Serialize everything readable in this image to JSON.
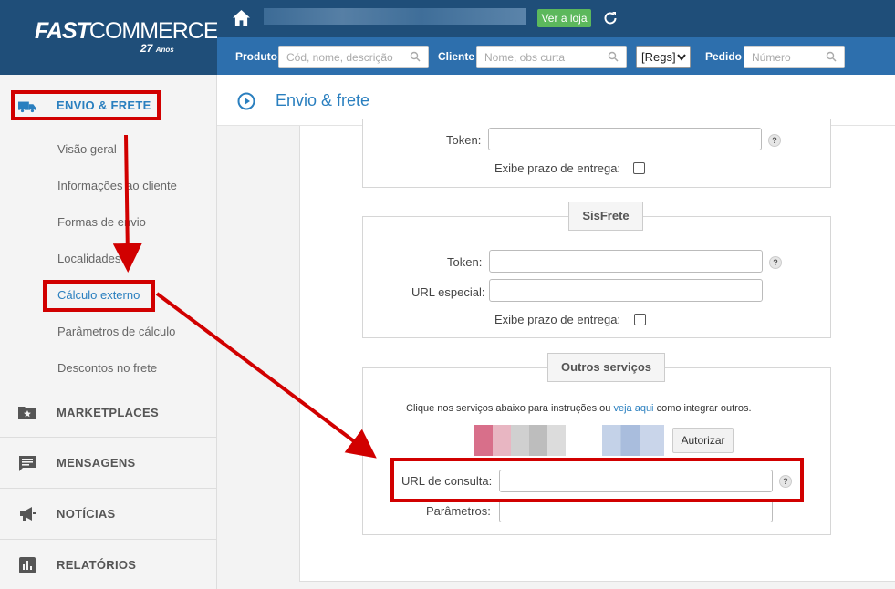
{
  "logo": {
    "brand_fast": "FAST",
    "brand_commerce": "COMMERCE",
    "years": "27",
    "years_label": "Anos"
  },
  "sidebar": {
    "active_section": "ENVIO & FRETE",
    "sub_items": [
      "Visão geral",
      "Informações ao cliente",
      "Formas de envio",
      "Localidades",
      "Cálculo externo",
      "Parâmetros de cálculo",
      "Descontos no frete"
    ],
    "active_sub": "Cálculo externo",
    "sections": [
      "MARKETPLACES",
      "MENSAGENS",
      "NOTÍCIAS",
      "RELATÓRIOS"
    ]
  },
  "topbar": {
    "store_button": "Ver a loja"
  },
  "searchbar": {
    "produto_label": "Produto",
    "produto_placeholder": "Cód, nome, descrição",
    "cliente_label": "Cliente",
    "cliente_placeholder": "Nome, obs curta",
    "select_value": "[Regs]",
    "pedido_label": "Pedido",
    "pedido_placeholder": "Número"
  },
  "page": {
    "title": "Envio & frete"
  },
  "form": {
    "top": {
      "token_label": "Token:",
      "prazo_label": "Exibe prazo de entrega:"
    },
    "sisfrete": {
      "legend": "SisFrete",
      "token_label": "Token:",
      "url_label": "URL especial:",
      "prazo_label": "Exibe prazo de entrega:"
    },
    "outros": {
      "legend": "Outros serviços",
      "info_prefix": "Clique nos serviços abaixo para instruções ou ",
      "info_link": "veja aqui",
      "info_suffix": " como integrar outros.",
      "authorize_button": "Autorizar",
      "url_label": "URL de consulta:",
      "params_label": "Parâmetros:"
    },
    "help_glyph": "?"
  },
  "colors": {
    "brand_dark": "#1f4e79",
    "brand_blue": "#2d6fad",
    "accent": "#2a7fbf",
    "highlight": "#d10000",
    "store_green": "#5cb85c"
  }
}
